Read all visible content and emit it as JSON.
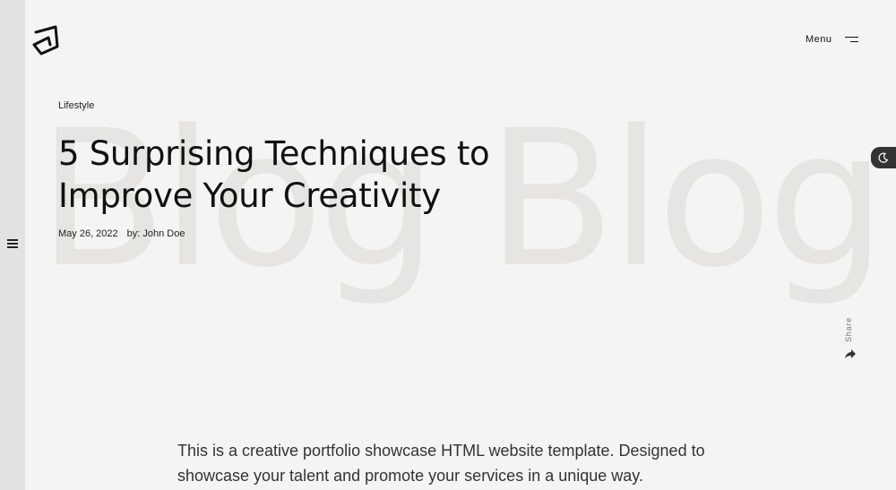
{
  "header": {
    "menu_label": "Menu",
    "logo_icon": "logo-mark-icon",
    "menu_icon": "menu-lines-icon"
  },
  "sidebar": {
    "toggle_icon": "hamburger-icon"
  },
  "background_word": "Blog Blog",
  "post": {
    "category": "Lifestyle",
    "title": "5 Surprising Techniques to Improve Your Creativity",
    "date": "May 26, 2022",
    "author": "by: John Doe",
    "intro": "This is a creative portfolio showcase HTML website template. Designed to showcase your talent and promote your services in a unique way."
  },
  "share": {
    "label": "Share",
    "icon": "share-arrow-icon"
  },
  "theme_toggle": {
    "icon": "moon-icon"
  },
  "colors": {
    "background": "#f4f4f4",
    "sidebar_strip": "#e2e2e2",
    "watermark": "#e6e5e1",
    "toggle_bg": "#333333"
  }
}
